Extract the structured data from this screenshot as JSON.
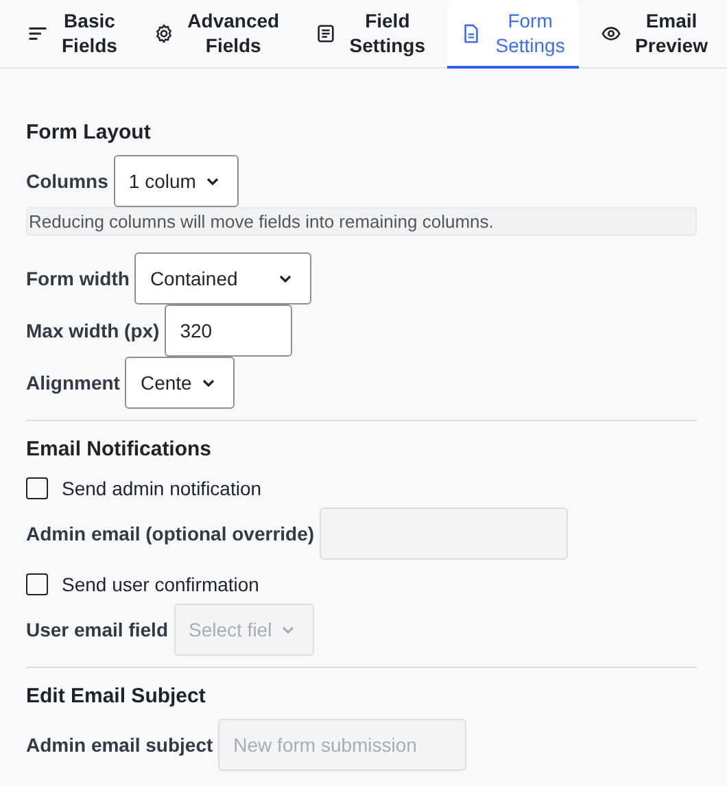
{
  "tabs": [
    {
      "label": "Basic\nFields",
      "selected": false
    },
    {
      "label": "Advanced\nFields",
      "selected": false
    },
    {
      "label": "Field\nSettings",
      "selected": false
    },
    {
      "label": "Form\nSettings",
      "selected": true
    },
    {
      "label": "Email\nPreview",
      "selected": false
    }
  ],
  "sections": [
    {
      "title": "Form Layout",
      "items": [
        {
          "kind": "select",
          "label": "Columns",
          "value": "1 colum",
          "disabled": false
        },
        {
          "kind": "note",
          "text": "Reducing columns will move fields into remaining columns."
        },
        {
          "kind": "select",
          "label": "Form width",
          "value": "Contained",
          "disabled": false
        },
        {
          "kind": "input",
          "label": "Max width (px)",
          "value": "320",
          "disabled": false
        },
        {
          "kind": "select",
          "label": "Alignment",
          "value": "Cente",
          "disabled": false
        }
      ]
    },
    {
      "title": "Email Notifications",
      "items": [
        {
          "kind": "checkbox",
          "label": "Send admin notification",
          "checked": false
        },
        {
          "kind": "input",
          "label": "Admin email (optional override)",
          "disabled": true
        },
        {
          "kind": "checkbox",
          "label": "Send user confirmation",
          "checked": false
        },
        {
          "kind": "select",
          "label": "User email field",
          "placeholder": "Select fiel",
          "disabled": true
        }
      ]
    },
    {
      "title": "Edit Email Subject",
      "items": [
        {
          "kind": "input",
          "label": "Admin email subject",
          "placeholder": "New form submission",
          "disabled": true
        }
      ]
    }
  ]
}
